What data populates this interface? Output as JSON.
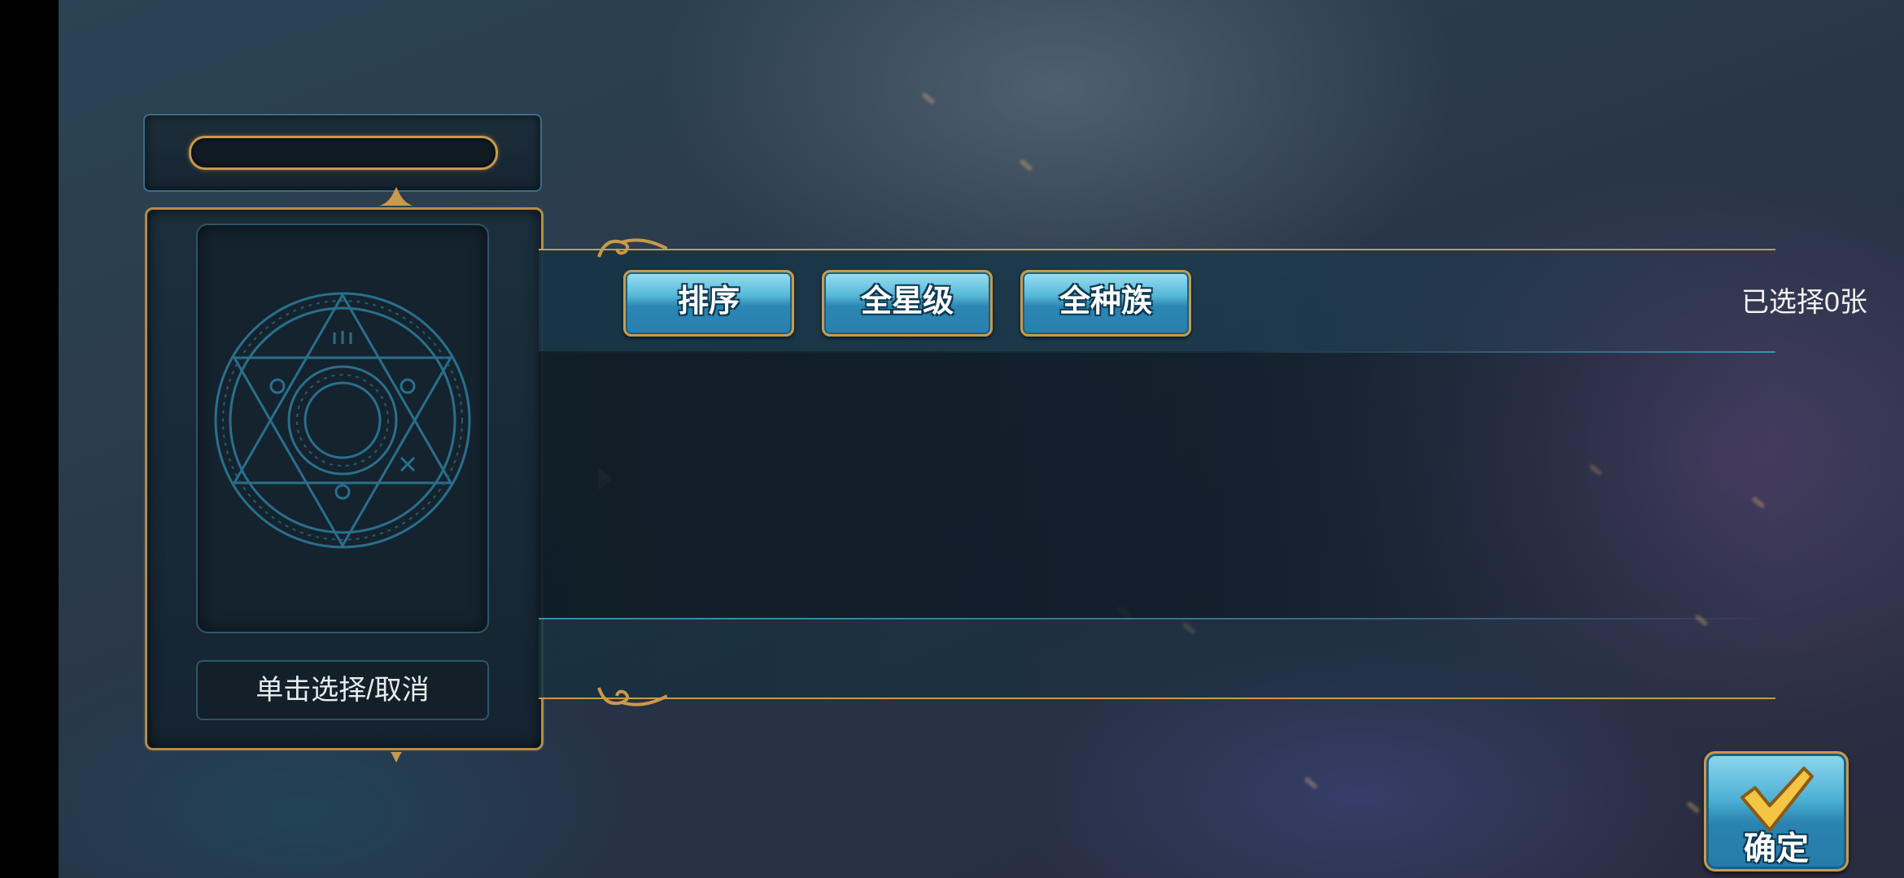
{
  "card_panel": {
    "name_plate": "",
    "hint": "单击选择/取消"
  },
  "filter_bar": {
    "sort_label": "排序",
    "star_filter_label": "全星级",
    "race_filter_label": "全种族",
    "selected_count": "已选择0张"
  },
  "confirm": {
    "label": "确定",
    "icon": "checkmark-icon"
  },
  "colors": {
    "gold_border": "#c79a4e",
    "button_blue": "#2b86b2",
    "panel_dark": "#152430"
  }
}
